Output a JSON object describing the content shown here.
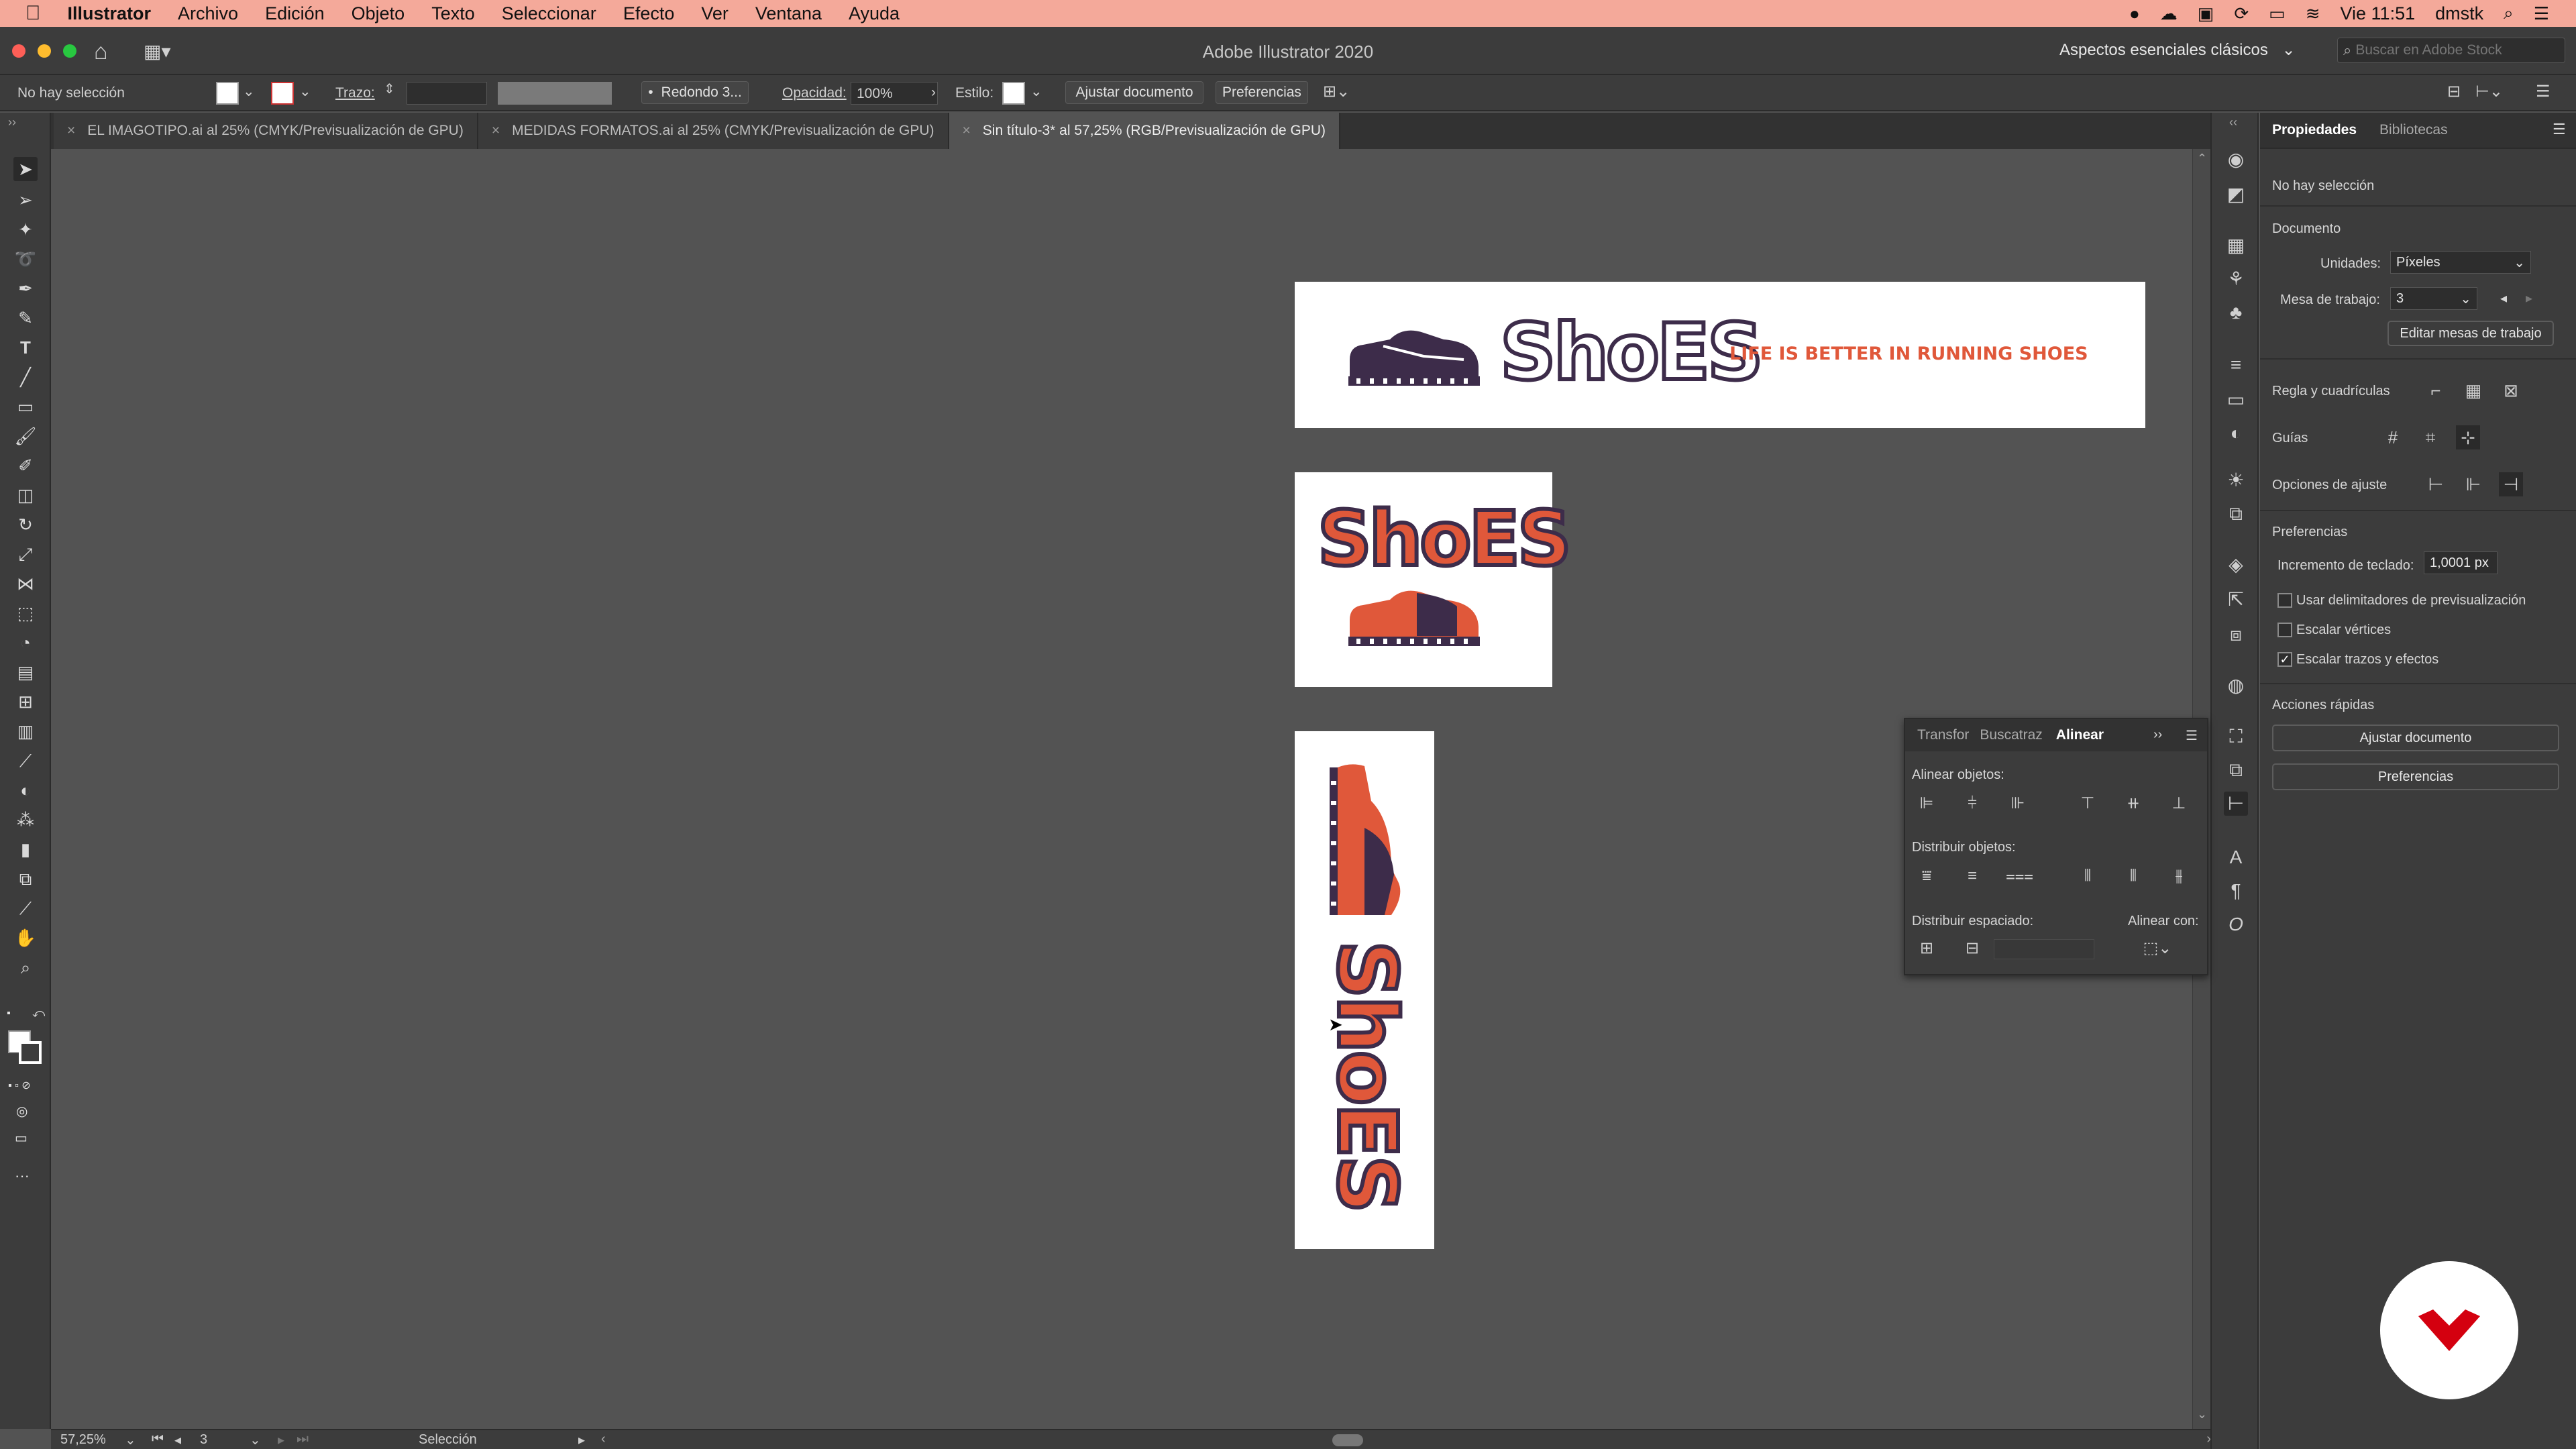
{
  "menubar": {
    "apple": "",
    "app": "Illustrator",
    "items": [
      "Archivo",
      "Edición",
      "Objeto",
      "Texto",
      "Seleccionar",
      "Efecto",
      "Ver",
      "Ventana",
      "Ayuda"
    ],
    "clock": "Vie 11:51",
    "user": "dmstk"
  },
  "window": {
    "title": "Adobe Illustrator 2020",
    "workspace": "Aspectos esenciales clásicos",
    "stock_placeholder": "Buscar en Adobe Stock"
  },
  "controlbar": {
    "selection": "No hay selección",
    "stroke_label": "Trazo:",
    "brush": "Redondo 3...",
    "opacity_label": "Opacidad:",
    "opacity_value": "100%",
    "style_label": "Estilo:",
    "fit_doc": "Ajustar documento",
    "prefs": "Preferencias"
  },
  "tabs": [
    {
      "label": "EL IMAGOTIPO.ai al 25% (CMYK/Previsualización de GPU)",
      "active": false
    },
    {
      "label": "MEDIDAS FORMATOS.ai al 25% (CMYK/Previsualización de GPU)",
      "active": false
    },
    {
      "label": "Sin título-3* al 57,25% (RGB/Previsualización de GPU)",
      "active": true
    }
  ],
  "artwork": {
    "wordmark": "ShoES",
    "tagline": "LIFE IS BETTER IN RUNNING SHOES",
    "colors": {
      "dark": "#3d2c4a",
      "orange": "#e0583a"
    }
  },
  "statusbar": {
    "zoom": "57,25%",
    "artboard": "3",
    "tool": "Selección"
  },
  "properties": {
    "tab_properties": "Propiedades",
    "tab_libraries": "Bibliotecas",
    "no_selection": "No hay selección",
    "document": "Documento",
    "units_label": "Unidades:",
    "units_value": "Píxeles",
    "artboard_label": "Mesa de trabajo:",
    "artboard_value": "3",
    "edit_artboards": "Editar mesas de trabajo",
    "rulers_grids": "Regla y cuadrículas",
    "guides": "Guías",
    "snap_options": "Opciones de ajuste",
    "preferences": "Preferencias",
    "keyboard_inc_label": "Incremento de teclado:",
    "keyboard_inc_value": "1,0001 px",
    "chk_preview_bounds": "Usar delimitadores de previsualización",
    "chk_scale_corners": "Escalar vértices",
    "chk_scale_strokes": "Escalar trazos y efectos",
    "quick_actions": "Acciones rápidas",
    "btn_fit_doc": "Ajustar documento",
    "btn_prefs": "Preferencias"
  },
  "align_panel": {
    "tab_transform": "Transfor",
    "tab_pathfinder": "Buscatraz",
    "tab_align": "Alinear",
    "align_objects": "Alinear objetos:",
    "distribute_objects": "Distribuir objetos:",
    "distribute_spacing": "Distribuir espaciado:",
    "align_to": "Alinear con:"
  }
}
